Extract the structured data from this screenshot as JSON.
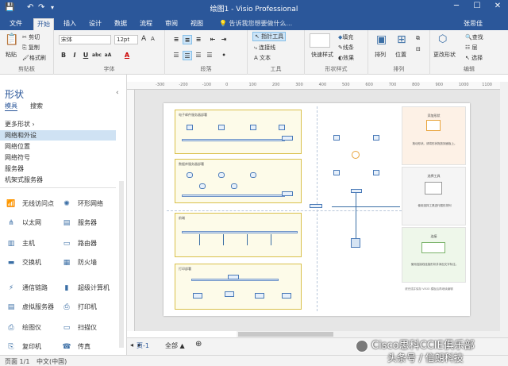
{
  "titlebar": {
    "title": "绘图1 - Visio Professional",
    "save_icon": "save-icon",
    "undo_icon": "undo-icon",
    "redo_icon": "redo-icon"
  },
  "tabs": {
    "items": [
      "文件",
      "开始",
      "插入",
      "设计",
      "数据",
      "流程",
      "审阅",
      "视图"
    ],
    "active": "开始",
    "tell_me": "告诉我您想要做什么...",
    "user": "张思佳"
  },
  "ribbon": {
    "clipboard": {
      "label": "剪贴板",
      "paste": "粘贴",
      "cut": "剪切",
      "copy": "复制",
      "format_painter": "格式刷"
    },
    "font": {
      "label": "字体",
      "family": "宋体",
      "size": "12pt"
    },
    "paragraph": {
      "label": "段落"
    },
    "tools": {
      "label": "工具",
      "pointer": "指针工具",
      "connector": "连接线",
      "text": "文本"
    },
    "shape_styles": {
      "label": "形状样式",
      "quick_styles": "快速样式",
      "fill": "填充",
      "line": "线条",
      "effects": "效果"
    },
    "arrange": {
      "label": "排列",
      "arrange": "排列",
      "position": "位置"
    },
    "edit": {
      "label": "编辑",
      "change_shape": "更改形状",
      "find": "查找",
      "layer": "层",
      "select": "选择"
    }
  },
  "shapes_pane": {
    "title": "形状",
    "tab_stencils": "模具",
    "tab_search": "搜索",
    "stencils": [
      "更多形状",
      "网络和外设",
      "网络位置",
      "网络符号",
      "服务器",
      "机架式服务器"
    ],
    "active_stencil": "网络和外设",
    "shapes": [
      [
        "无线访问点",
        "环形网络"
      ],
      [
        "以太网",
        "服务器"
      ],
      [
        "主机",
        "路由器"
      ],
      [
        "交换机",
        "防火墙"
      ],
      [
        "通信链路",
        "超级计算机"
      ],
      [
        "虚拟服务器",
        "打印机"
      ],
      [
        "绘图仪",
        "扫描仪"
      ],
      [
        "复印机",
        "传真"
      ]
    ]
  },
  "ruler": {
    "marks": [
      "-300",
      "-200",
      "-100",
      "0",
      "100",
      "200",
      "300",
      "400",
      "500",
      "600",
      "700",
      "800",
      "900",
      "1000",
      "1100",
      "1200"
    ]
  },
  "diagram": {
    "zones": [
      "电子邮件服务器部署",
      "数据库服务器部署",
      "前端",
      "打印部署"
    ],
    "side_titles": [
      "添加形状",
      "选择工具",
      "连接"
    ],
    "side_descs": [
      "拖动形状。请将形状拖放到面板上。",
      "使用选择工具进行图形排列",
      "使用连接线连接形状并添加文字标注。"
    ],
    "footnote": "请完成并保存 VISIO 模板后再继续编辑"
  },
  "page_tabs": {
    "page": "页-1",
    "all": "全部",
    "all_arrow": "▲",
    "add": "⊕"
  },
  "status": {
    "page": "页面 1/1",
    "lang": "中文(中国)"
  },
  "watermark": {
    "line1": "Cisco思科CCIE俱乐部",
    "line2": "头条号 / 信朗科技"
  }
}
